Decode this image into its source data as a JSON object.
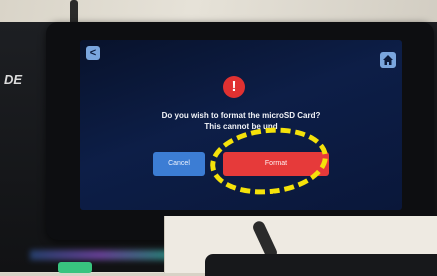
{
  "screen": {
    "back_icon": "back-arrow-icon",
    "home_icon": "home-icon",
    "warning_icon": "exclamation-icon",
    "warning_glyph": "!",
    "back_glyph": "<",
    "question": "Do you wish to format the microSD Card?",
    "warning_line": "This cannot be und",
    "cancel_label": "Cancel",
    "format_label": "Format"
  },
  "device": {
    "brand_text": "DE"
  },
  "annotation": {
    "color": "#f5e20a",
    "shape": "dashed-ellipse"
  },
  "colors": {
    "screen_bg": "#0d1e47",
    "cancel": "#3c7dd4",
    "format": "#e63a3a",
    "warning": "#e03131"
  }
}
